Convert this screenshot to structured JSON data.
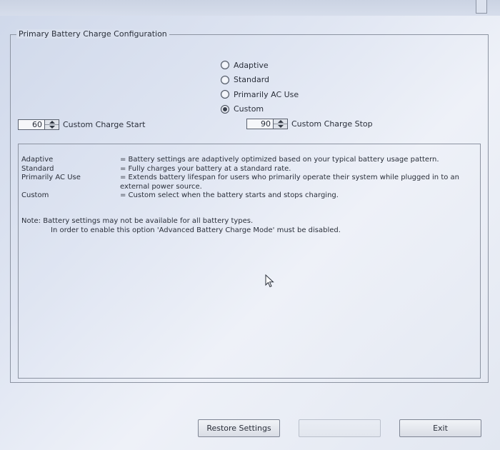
{
  "group": {
    "title": "Primary Battery Charge Configuration"
  },
  "modes": [
    {
      "label": "Adaptive",
      "selected": false
    },
    {
      "label": "Standard",
      "selected": false
    },
    {
      "label": "Primarily AC Use",
      "selected": false
    },
    {
      "label": "Custom",
      "selected": true
    }
  ],
  "custom_start": {
    "value": "60",
    "label": "Custom Charge Start"
  },
  "custom_stop": {
    "value": "90",
    "label": "Custom Charge Stop"
  },
  "descriptions": [
    {
      "term": "Adaptive",
      "text": "= Battery settings are adaptively optimized based on your typical battery usage pattern."
    },
    {
      "term": "Standard",
      "text": "= Fully charges your battery at a standard rate."
    },
    {
      "term": "Primarily AC Use",
      "text": "= Extends battery lifespan for users who primarily operate their system while plugged in to an external power source."
    },
    {
      "term": "Custom",
      "text": "= Custom select when the battery starts and stops charging."
    }
  ],
  "note": {
    "line1": "Note:  Battery settings may not be available for all battery types.",
    "line2": "In order to enable this option 'Advanced Battery Charge Mode' must be disabled."
  },
  "buttons": {
    "restore": "Restore Settings",
    "apply": "",
    "exit": "Exit"
  }
}
